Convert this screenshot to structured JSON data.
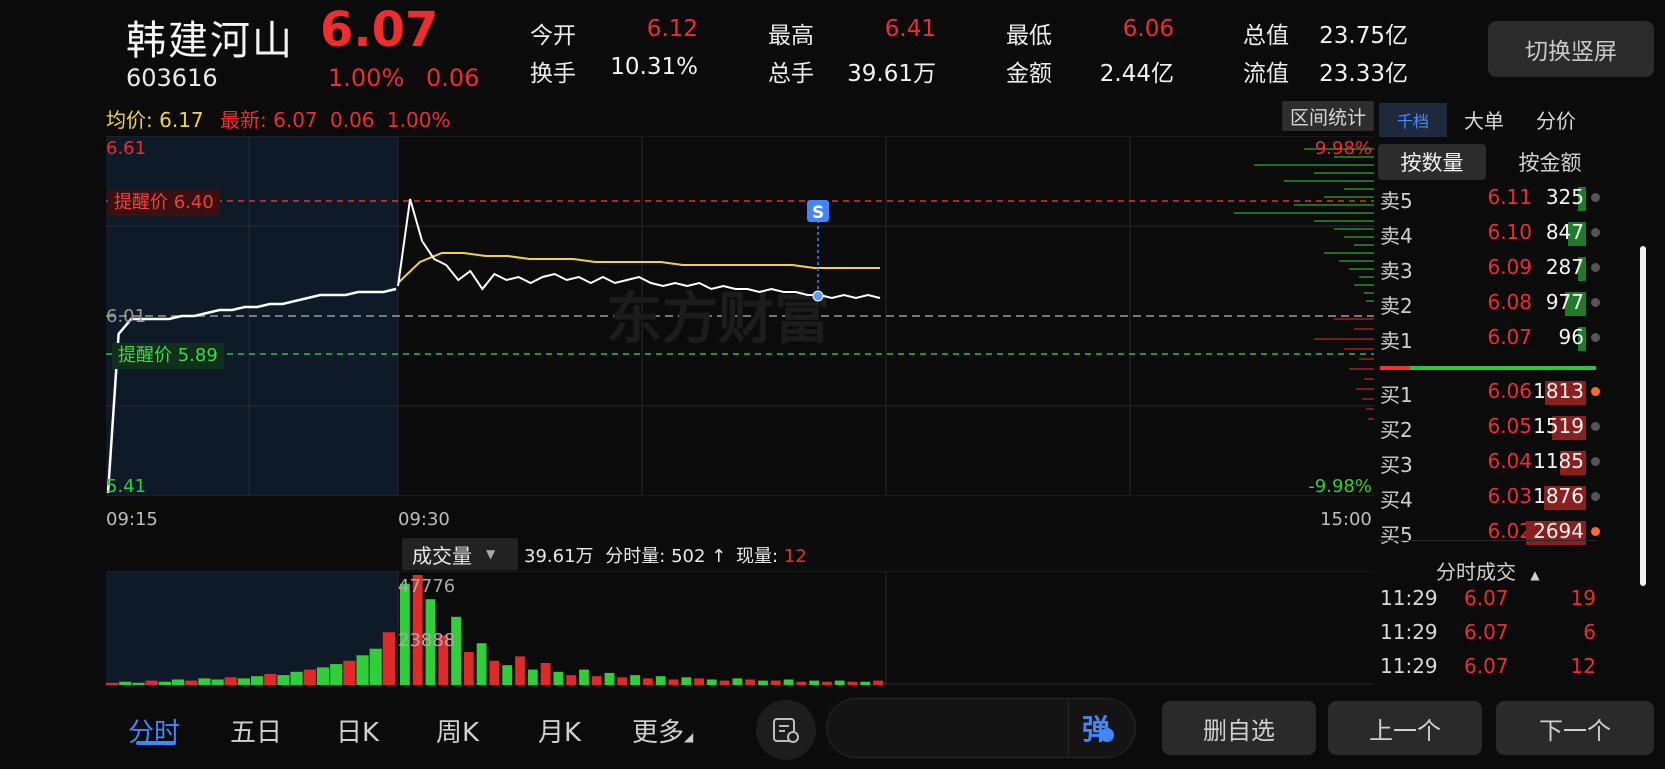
{
  "header": {
    "name": "韩建河山",
    "price": "6.07",
    "code": "603616",
    "change_pct": "1.00%",
    "change_val": "0.06",
    "stats": [
      {
        "label": "今开",
        "value": "6.12",
        "color": "red"
      },
      {
        "label": "最高",
        "value": "6.41",
        "color": "red"
      },
      {
        "label": "最低",
        "value": "6.06",
        "color": "red"
      },
      {
        "label": "总值",
        "value": "23.75亿",
        "color": "white"
      },
      {
        "label": "换手",
        "value": "10.31%",
        "color": "white"
      },
      {
        "label": "总手",
        "value": "39.61万",
        "color": "white"
      },
      {
        "label": "金额",
        "value": "2.44亿",
        "color": "white"
      },
      {
        "label": "流值",
        "value": "23.33亿",
        "color": "white"
      }
    ],
    "switch_label": "切换竖屏"
  },
  "info_line": {
    "avg_label": "均价:",
    "avg_value": "6.17",
    "latest_label": "最新:",
    "latest_price": "6.07",
    "latest_change": "0.06",
    "latest_pct": "1.00%"
  },
  "range_stats_label": "区间统计",
  "chart_axis": {
    "y_top": "6.61",
    "y_mid": "6.01",
    "y_bottom": "5.41",
    "pct_top": "9.98%",
    "pct_bottom": "-9.98%",
    "x_labels": [
      "09:15",
      "09:30",
      "15:00"
    ],
    "alert_high": "提醒价 6.40",
    "alert_low": "提醒价 5.89",
    "marker_letter": "S",
    "watermark": "东方财富"
  },
  "chart_data": {
    "type": "line",
    "ylim": [
      5.41,
      6.61
    ],
    "prev_close": 6.01,
    "alerts": [
      6.4,
      5.89
    ],
    "series": [
      {
        "color": "#ffffff",
        "values_preopen": [
          5.42,
          5.95,
          6.0,
          6.0,
          6.0,
          6.0,
          6.01,
          6.01,
          6.02,
          6.03,
          6.03,
          6.04,
          6.04,
          6.05,
          6.05,
          6.06,
          6.07,
          6.08,
          6.08,
          6.08,
          6.09,
          6.09,
          6.09,
          6.1
        ]
      },
      {
        "color": "#ffffff",
        "values_trading": [
          6.11,
          6.4,
          6.26,
          6.2,
          6.18,
          6.13,
          6.16,
          6.1,
          6.15,
          6.13,
          6.14,
          6.12,
          6.14,
          6.15,
          6.13,
          6.14,
          6.12,
          6.14,
          6.12,
          6.13,
          6.14,
          6.12,
          6.11,
          6.12,
          6.11,
          6.12,
          6.1,
          6.11,
          6.1,
          6.1,
          6.09,
          6.1,
          6.09,
          6.09,
          6.08,
          6.08,
          6.07,
          6.08,
          6.07,
          6.08,
          6.07
        ]
      },
      {
        "color": "#f0d24a",
        "avg_values": [
          6.12,
          6.19,
          6.22,
          6.22,
          6.21,
          6.21,
          6.2,
          6.2,
          6.2,
          6.19,
          6.19,
          6.19,
          6.19,
          6.18,
          6.18,
          6.18,
          6.18,
          6.18,
          6.18,
          6.17,
          6.17,
          6.17,
          6.17
        ]
      }
    ],
    "volume": {
      "max_label": "47776",
      "mid_label": "23888",
      "values": [
        2,
        3,
        2,
        4,
        3,
        5,
        4,
        6,
        5,
        7,
        6,
        8,
        10,
        9,
        12,
        14,
        16,
        19,
        22,
        27,
        33,
        48,
        92,
        100,
        78,
        45,
        62,
        30,
        38,
        22,
        18,
        26,
        14,
        20,
        12,
        9,
        14,
        8,
        11,
        7,
        9,
        6,
        8,
        5,
        7,
        6,
        5,
        4,
        6,
        5,
        4,
        4,
        5,
        3,
        4,
        3,
        4,
        3,
        3,
        4
      ]
    }
  },
  "volume_bar": {
    "selector_label": "成交量",
    "total": "39.61万",
    "minute_label": "分时量:",
    "minute_value": "502",
    "arrow": "↑",
    "current_label": "现量:",
    "current_value": "12"
  },
  "right_panel": {
    "tabs": [
      "千档",
      "大单",
      "分价"
    ],
    "seg": [
      "按数量",
      "按金额"
    ],
    "sells": [
      {
        "label": "卖5",
        "price": "6.11",
        "qty": "325",
        "fill": 0.1
      },
      {
        "label": "卖4",
        "price": "6.10",
        "qty": "847",
        "fill": 0.3
      },
      {
        "label": "卖3",
        "price": "6.09",
        "qty": "287",
        "fill": 0.1
      },
      {
        "label": "卖2",
        "price": "6.08",
        "qty": "977",
        "fill": 0.35
      },
      {
        "label": "卖1",
        "price": "6.07",
        "qty": "96",
        "fill": 0.04
      }
    ],
    "buys": [
      {
        "label": "买1",
        "price": "6.06",
        "qty": "1813",
        "fill": 0.68
      },
      {
        "label": "买2",
        "price": "6.05",
        "qty": "1519",
        "fill": 0.56
      },
      {
        "label": "买3",
        "price": "6.04",
        "qty": "1185",
        "fill": 0.44
      },
      {
        "label": "买4",
        "price": "6.03",
        "qty": "1876",
        "fill": 0.7
      },
      {
        "label": "买5",
        "price": "6.02",
        "qty": "2694",
        "fill": 1.0
      }
    ],
    "tick_title": "分时成交",
    "ticks": [
      {
        "time": "11:29",
        "price": "6.07",
        "vol": "19"
      },
      {
        "time": "11:29",
        "price": "6.07",
        "vol": "6"
      },
      {
        "time": "11:29",
        "price": "6.07",
        "vol": "12"
      }
    ]
  },
  "bottom_nav": {
    "tabs": [
      "分时",
      "五日",
      "日K",
      "周K",
      "月K",
      "更多"
    ],
    "danmu_icon": "弹",
    "buttons": [
      "删自选",
      "上一个",
      "下一个"
    ]
  },
  "colors": {
    "up": "#f02c2c",
    "down": "#2fcf3a",
    "avg": "#f0d24a",
    "accent": "#3f86ff"
  }
}
